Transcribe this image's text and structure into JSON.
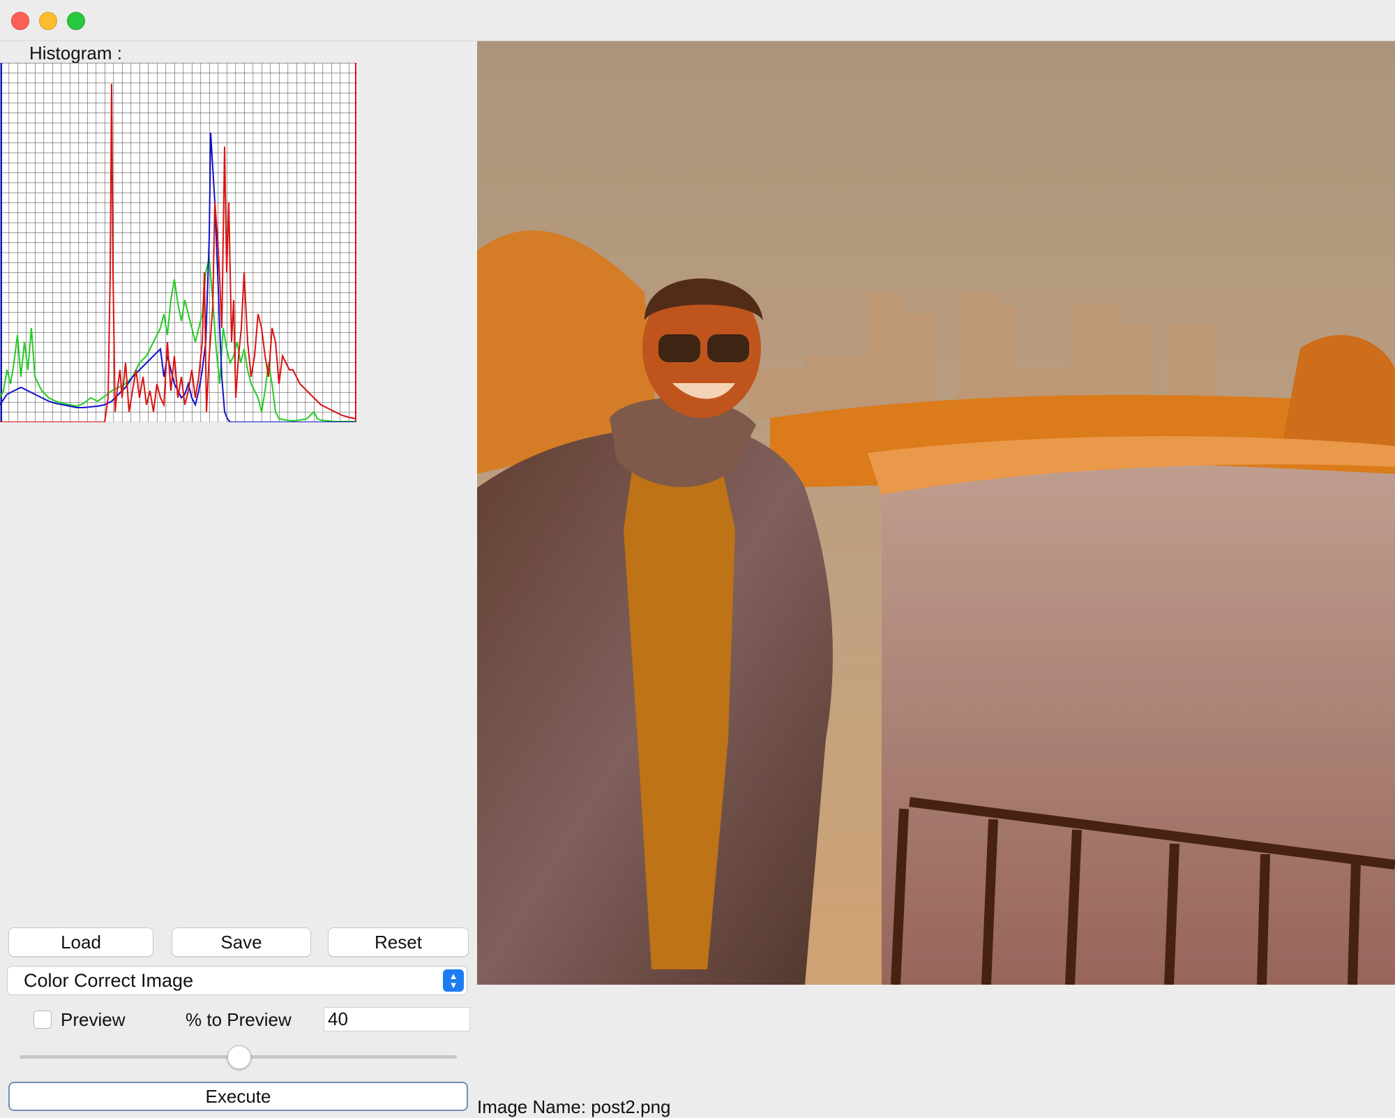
{
  "window": {
    "title": ""
  },
  "histogram": {
    "label": "Histogram :",
    "colors": {
      "red": "#dd1111",
      "green": "#22cc22",
      "blue": "#1111cc"
    }
  },
  "toolbar": {
    "load_label": "Load",
    "save_label": "Save",
    "reset_label": "Reset"
  },
  "operation": {
    "selected": "Color Correct Image"
  },
  "preview": {
    "checkbox_label": "Preview",
    "checked": false,
    "percent_label": "% to Preview",
    "percent_value": "40",
    "slider_value": 0.5
  },
  "execute": {
    "label": "Execute"
  },
  "image": {
    "name_text": "Image Name: post2.png"
  }
}
